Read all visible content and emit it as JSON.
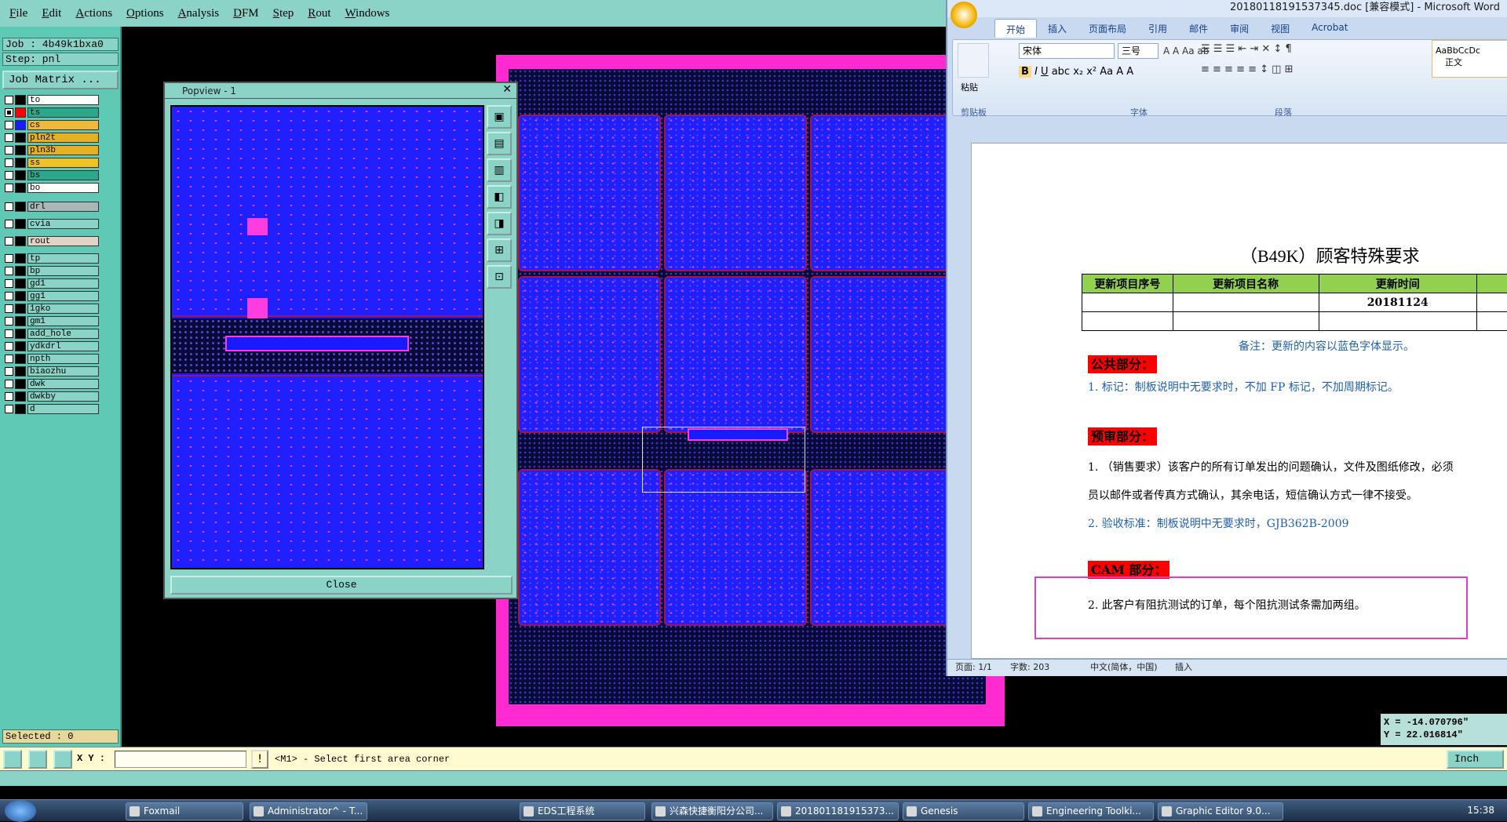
{
  "genesis": {
    "menu": [
      "File",
      "Edit",
      "Actions",
      "Options",
      "Analysis",
      "DFM",
      "Step",
      "Rout",
      "Windows"
    ],
    "job_label": "Job : 4b49k1bxa0",
    "step_label": "Step: pnl",
    "job_matrix": "Job Matrix ...",
    "layers": [
      {
        "name": "to",
        "color": "#ffffff",
        "swatch": "#000000"
      },
      {
        "name": "ts",
        "color": "#2ba88a",
        "swatch": "#ff0000"
      },
      {
        "name": "cs",
        "color": "#f0b93a",
        "swatch": "#1a1aff"
      },
      {
        "name": "pln2t",
        "color": "#e6b022",
        "swatch": "#000000"
      },
      {
        "name": "pln3b",
        "color": "#e6b022",
        "swatch": "#000000"
      },
      {
        "name": "ss",
        "color": "#f0c22a",
        "swatch": "#000000"
      },
      {
        "name": "bs",
        "color": "#2ba88a",
        "swatch": "#000000"
      },
      {
        "name": "bo",
        "color": "#ffffff",
        "swatch": "#000000"
      },
      {
        "name": "drl",
        "color": "#a9b7b7",
        "swatch": "#000000"
      },
      {
        "name": "cvia",
        "color": "#8ad3c6",
        "swatch": "#000000"
      },
      {
        "name": "rout",
        "color": "#e3d3c6",
        "swatch": "#000000"
      },
      {
        "name": "tp",
        "color": "#8ad3c6",
        "swatch": "#000000"
      },
      {
        "name": "bp",
        "color": "#8ad3c6",
        "swatch": "#000000"
      },
      {
        "name": "gd1",
        "color": "#8ad3c6",
        "swatch": "#000000"
      },
      {
        "name": "gg1",
        "color": "#8ad3c6",
        "swatch": "#000000"
      },
      {
        "name": "1gko",
        "color": "#8ad3c6",
        "swatch": "#000000"
      },
      {
        "name": "gm1",
        "color": "#8ad3c6",
        "swatch": "#000000"
      },
      {
        "name": "add_hole",
        "color": "#8ad3c6",
        "swatch": "#000000"
      },
      {
        "name": "ydkdrl",
        "color": "#8ad3c6",
        "swatch": "#000000"
      },
      {
        "name": "npth",
        "color": "#8ad3c6",
        "swatch": "#000000"
      },
      {
        "name": "biaozhu",
        "color": "#8ad3c6",
        "swatch": "#000000"
      },
      {
        "name": "dwk",
        "color": "#8ad3c6",
        "swatch": "#000000"
      },
      {
        "name": "dwkby",
        "color": "#8ad3c6",
        "swatch": "#000000"
      },
      {
        "name": "d",
        "color": "#8ad3c6",
        "swatch": "#000000"
      }
    ],
    "selected": "Selected : 0",
    "xy_label": "X Y :",
    "prompt": "<M1> - Select first area corner",
    "units": "Inch",
    "coord_x": "X = -14.070796\"",
    "coord_y": "Y = 22.016814\""
  },
  "popview": {
    "title": "Popview - 1",
    "close_label": "Close"
  },
  "word": {
    "title": "201801181915373​45.doc [兼容模式] - Microsoft Word",
    "tabs": [
      "开始",
      "插入",
      "页面布局",
      "引用",
      "邮件",
      "审阅",
      "视图",
      "Acrobat"
    ],
    "font_name": "宋体",
    "font_size": "三号",
    "style_sample": "AaBbCcDc",
    "style_name": "正文",
    "group_labels": [
      "剪贴板",
      "字体",
      "段落"
    ],
    "paste_label": "粘贴",
    "doc_title": "（B49K）顾客特殊要求",
    "table_headers": [
      "更新项目序号",
      "更新项目名称",
      "更新时间"
    ],
    "table_date": "20181124",
    "note": "备注：更新的内容以蓝色字体显示。",
    "sec1": "公共部分：",
    "item1": "1. 标记：制板说明中无要求时，不加 FP 标记，不加周期标记。",
    "sec2": "预审部分：",
    "item2a": "1. （销售要求）该客户的所有订单发出的问题确认，文件及图纸修改，必须",
    "item2b": "员以邮件或者传真方式确认，其余电话，短信确认方式一律不接受。",
    "item3": "2. 验收标准：制板说明中无要求时，GJB362B-2009",
    "sec3": "CAM 部分：",
    "item4": "2. 此客户有阻抗测试的订单，每个阻抗测试条需加两组。",
    "status_page": "页面: 1/1",
    "status_words": "字数: 203",
    "status_lang": "中文(简体，中国)",
    "status_insert": "插入"
  },
  "taskbar": {
    "items": [
      "Foxmail",
      "Administrator^ - T...",
      "EDS工程系统",
      "兴森快捷衡阳分公司...",
      "2018011819153​73...",
      "Genesis",
      "Engineering Toolki...",
      "Graphic Editor 9.0..."
    ],
    "clock": "15:38"
  }
}
